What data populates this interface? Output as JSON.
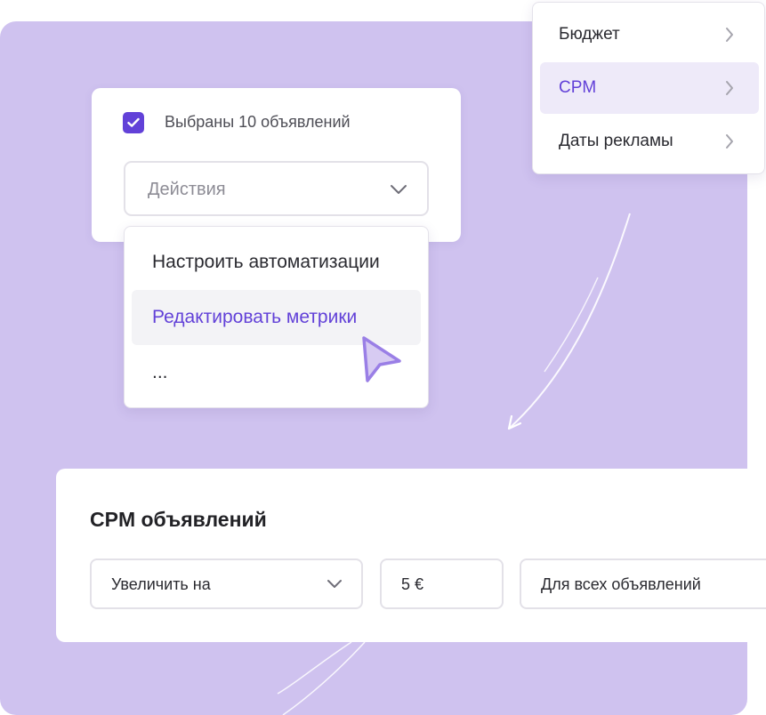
{
  "selection": {
    "count_label": "Выбраны 10 объявлений",
    "checked": true,
    "actions_placeholder": "Действия"
  },
  "actions_menu": {
    "items": [
      {
        "label": "Настроить автоматизации",
        "active": false
      },
      {
        "label": "Редактировать метрики",
        "active": true
      },
      {
        "label": "...",
        "active": false
      }
    ]
  },
  "category_menu": {
    "items": [
      {
        "label": "Бюджет",
        "active": false
      },
      {
        "label": "CPM",
        "active": true
      },
      {
        "label": "Даты рекламы",
        "active": false
      }
    ]
  },
  "cpm_panel": {
    "title": "CPM объявлений",
    "operation": "Увеличить на",
    "amount": "5 €",
    "scope": "Для всех объявлений"
  },
  "colors": {
    "accent": "#6241d8",
    "background": "#cfc2ef",
    "active_item_bg": "#eeeaf9"
  },
  "icons": [
    "check-icon",
    "chevron-down-icon",
    "chevron-right-icon",
    "cursor-pointer-icon"
  ]
}
